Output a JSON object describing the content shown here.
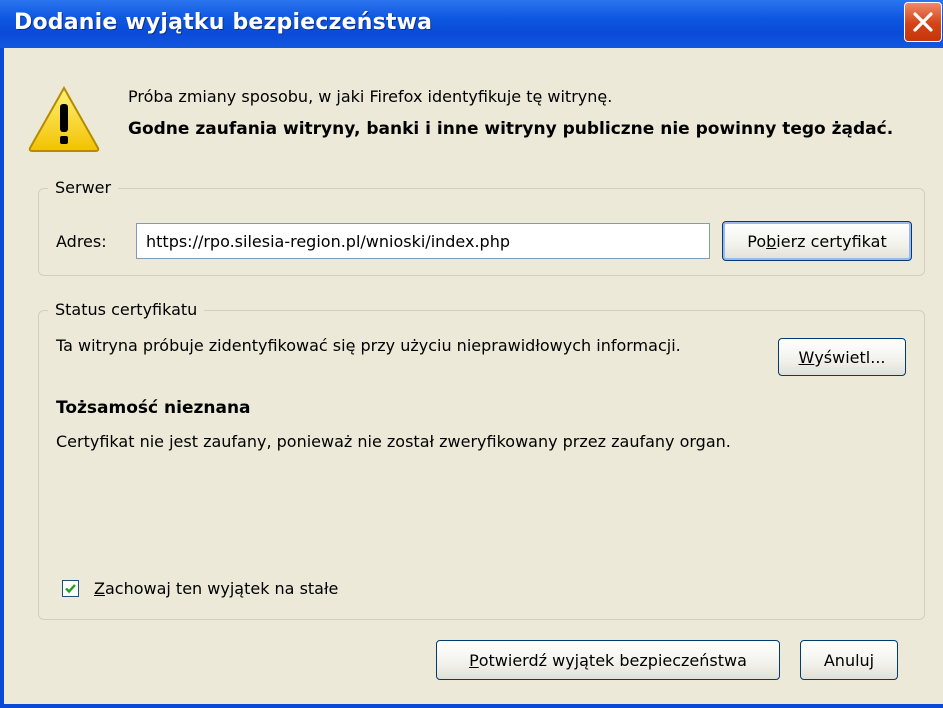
{
  "window": {
    "title": "Dodanie wyjątku bezpieczeństwa",
    "titlebar_color": "#0a4bd8",
    "close_icon": "close-icon"
  },
  "header": {
    "icon": "warning-icon",
    "intro": "Próba zmiany sposobu, w jaki Firefox identyfikuje tę witrynę.",
    "warning": "Godne zaufania witryny, banki i inne witryny publiczne nie powinny tego żądać."
  },
  "server": {
    "legend": "Serwer",
    "address_label": "Adres:",
    "address_value": "https://rpo.silesia-region.pl/wnioski/index.php",
    "fetch_button_pre": "Po",
    "fetch_button_accel": "b",
    "fetch_button_post": "ierz certyfikat"
  },
  "status": {
    "legend": "Status certyfikatu",
    "message": "Ta witryna próbuje zidentyfikować się przy użyciu nieprawidłowych informacji.",
    "view_button_pre": "",
    "view_button_accel": "W",
    "view_button_post": "yświetl...",
    "identity_heading": "Tożsamość nieznana",
    "identity_detail": "Certyfikat nie jest zaufany, ponieważ nie został zweryfikowany przez zaufany organ.",
    "permanent_checkbox_checked": true,
    "permanent_label_accel": "Z",
    "permanent_label_post": "achowaj ten wyjątek na stałe"
  },
  "footer": {
    "confirm_accel": "P",
    "confirm_post": "otwierdź wyjątek bezpieczeństwa",
    "cancel_label": "Anuluj"
  },
  "colors": {
    "dialog_background": "#ece9d8",
    "button_border": "#003c74",
    "close_button": "#d34316"
  }
}
